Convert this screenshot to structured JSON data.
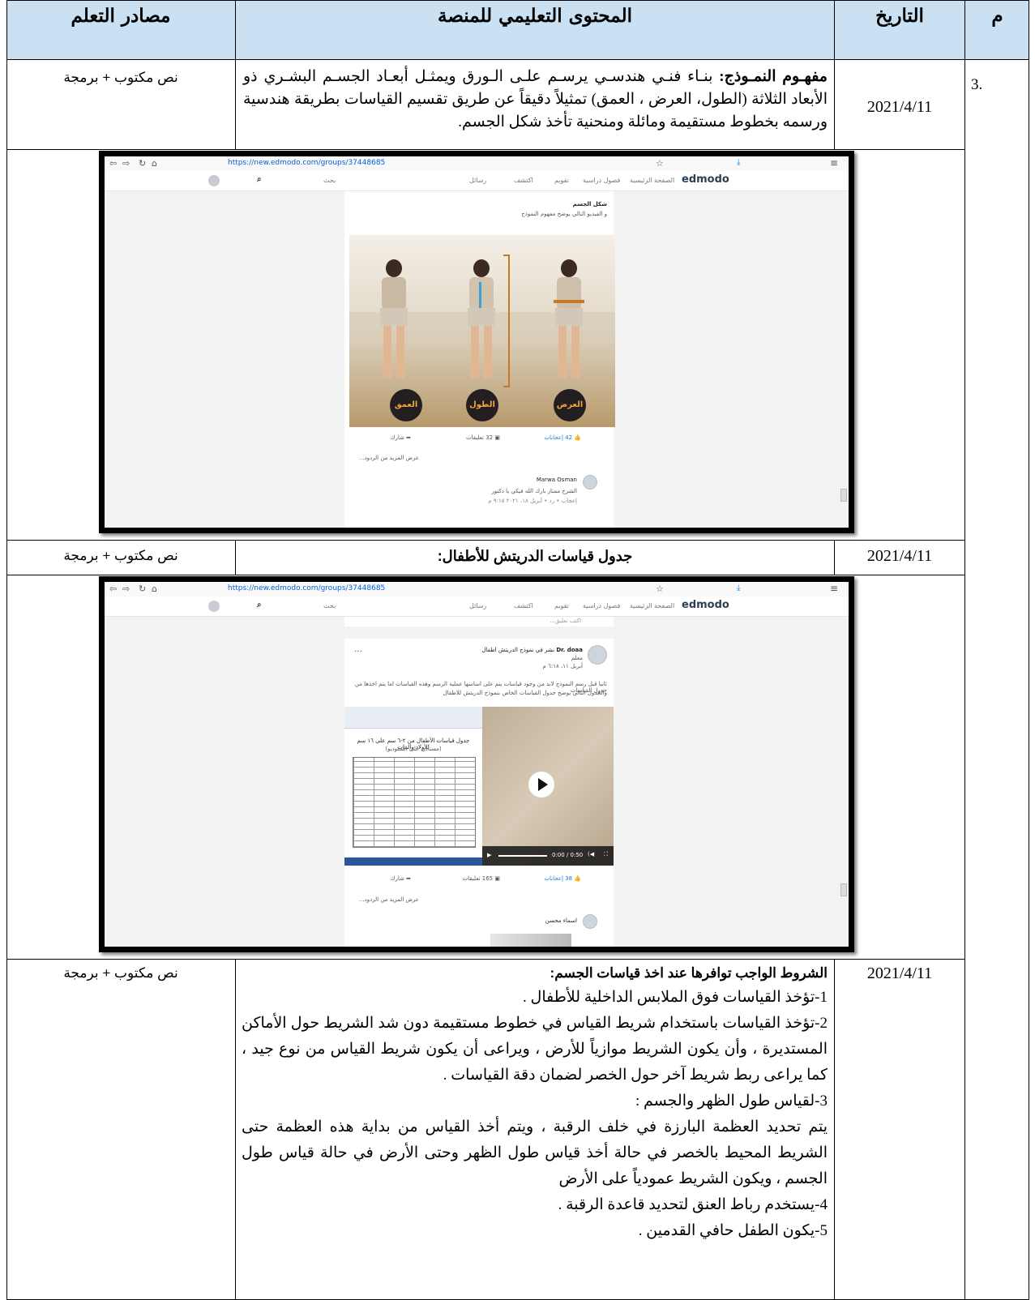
{
  "table": {
    "headers": {
      "index": "م",
      "date": "التاريخ",
      "content": "المحتوى التعليمي للمنصة",
      "sources": "مصادر التعلم"
    }
  },
  "row1": {
    "index": "3.",
    "date": "2021/4/11",
    "concept_term": "مفهـوم النمـوذج:",
    "concept_text": " بنـاء فنـي هندسـي يرسـم علـى الـورق ويمثـل أبعـاد الجسـم البشـري ذو الأبعاد الثلاثة (الطول، العرض ، العمق) تمثيلاً دقيقاً عن طريق تقسيم القياسات بطريقة هندسية ورسمه بخطوط مستقيمة ومائلة ومنحنية تأخذ شكل الجسم.",
    "source": "نص  مكتوب + برمجة"
  },
  "screenshot1": {
    "url": "https://new.edmodo.com/groups/37448685",
    "brand": "edmodo",
    "nav_items": [
      "الصفحة الرئيسية",
      "فصول دراسية",
      "تقويم",
      "اكتشف",
      "رسائل"
    ],
    "search_placeholder": "بحث",
    "post_line1": "شكل الجسم",
    "post_line2": "و الفيديو التالي يوضح مفهوم النموذج",
    "labels": [
      "العمق",
      "الطول",
      "العرض"
    ],
    "likes": "42 إعجابات",
    "comments": "32 تعليقات",
    "share": "شارك",
    "more_replies": "عرض المزيد من الردود...",
    "commenter": "Marwa Osman",
    "comment_text": "الشرح ممتاز بارك الله فيكي يا دكتور",
    "comment_meta": "إعجاب • رد • أبريل ١٨، ٢٠٢١ ٩:١٥ م"
  },
  "row2": {
    "date": "2021/4/11",
    "title": "جدول قياسات الدريتش للأطفال:",
    "source": "نص  مكتوب + برمجة"
  },
  "screenshot2": {
    "url": "https://new.edmodo.com/groups/37448685",
    "brand": "edmodo",
    "nav_items": [
      "الصفحة الرئيسية",
      "فصول دراسية",
      "تقويم",
      "اكتشف",
      "رسائل"
    ],
    "search_placeholder": "بحث",
    "write_comment": "اكتب تعليق...",
    "poster": "Dr. doaa",
    "poster_action": "نشر في نموذج الدريتش اطفال",
    "poster_role": "معلم",
    "poster_time": "أبريل ١١، ٦:١٨ م",
    "post_line1": "ثانيا قبل رسم النموذج لابد من وجود قياسات يتم على اساسها عملية الرسم وهذه القياسات اما يتم اخذها من جدول القياسات",
    "post_line2": "والجدول التالي يوضح جدول القياسات الخاص بنموذج الدريتش للاطفال",
    "doc_title": "جدول قياسات الأطفال من ٢-٦ سم على ١٦ سم للأولاد والبنات",
    "doc_subtitle": "(مستأذن على الستوديو)",
    "video_time": "0:00 / 0:50",
    "likes": "38 إعجابات",
    "comments": "165 تعليقات",
    "share": "شارك",
    "more_replies": "عرض المزيد من الردود...",
    "commenter": "اسماء محسن"
  },
  "row3": {
    "date": "2021/4/11",
    "source": "نص  مكتوب + برمجة",
    "heading": "الشروط الواجب توافرها عند اخذ قياسات الجسم:",
    "lines": [
      "1-تؤخذ القياسات فوق الملابس الداخلية للأطفال .",
      "2-تؤخذ القياسات باستخدام شريط القياس في خطوط مستقيمة دون شد الشريط حول الأماكن المستديرة ، وأن يكون الشريط موازياً للأرض ، ويراعى أن يكون شريط القياس من نوع جيد ، كما يراعى ربط شريط آخر حول الخصر لضمان دقة القياسات .",
      "3-لقياس طول الظهر والجسم :",
      "يتم تحديد العظمة البارزة في خلف الرقبة ، ويتم أخذ القياس من بداية هذه العظمة حتى الشريط المحيط بالخصر في حالة أخذ قياس طول الظهر وحتى الأرض في حالة قياس طول الجسم ، ويكون الشريط عمودياً على الأرض",
      "4-يستخدم رباط العنق لتحديد قاعدة الرقبة .",
      "5-يكون الطفل حافي القدمين ."
    ]
  }
}
